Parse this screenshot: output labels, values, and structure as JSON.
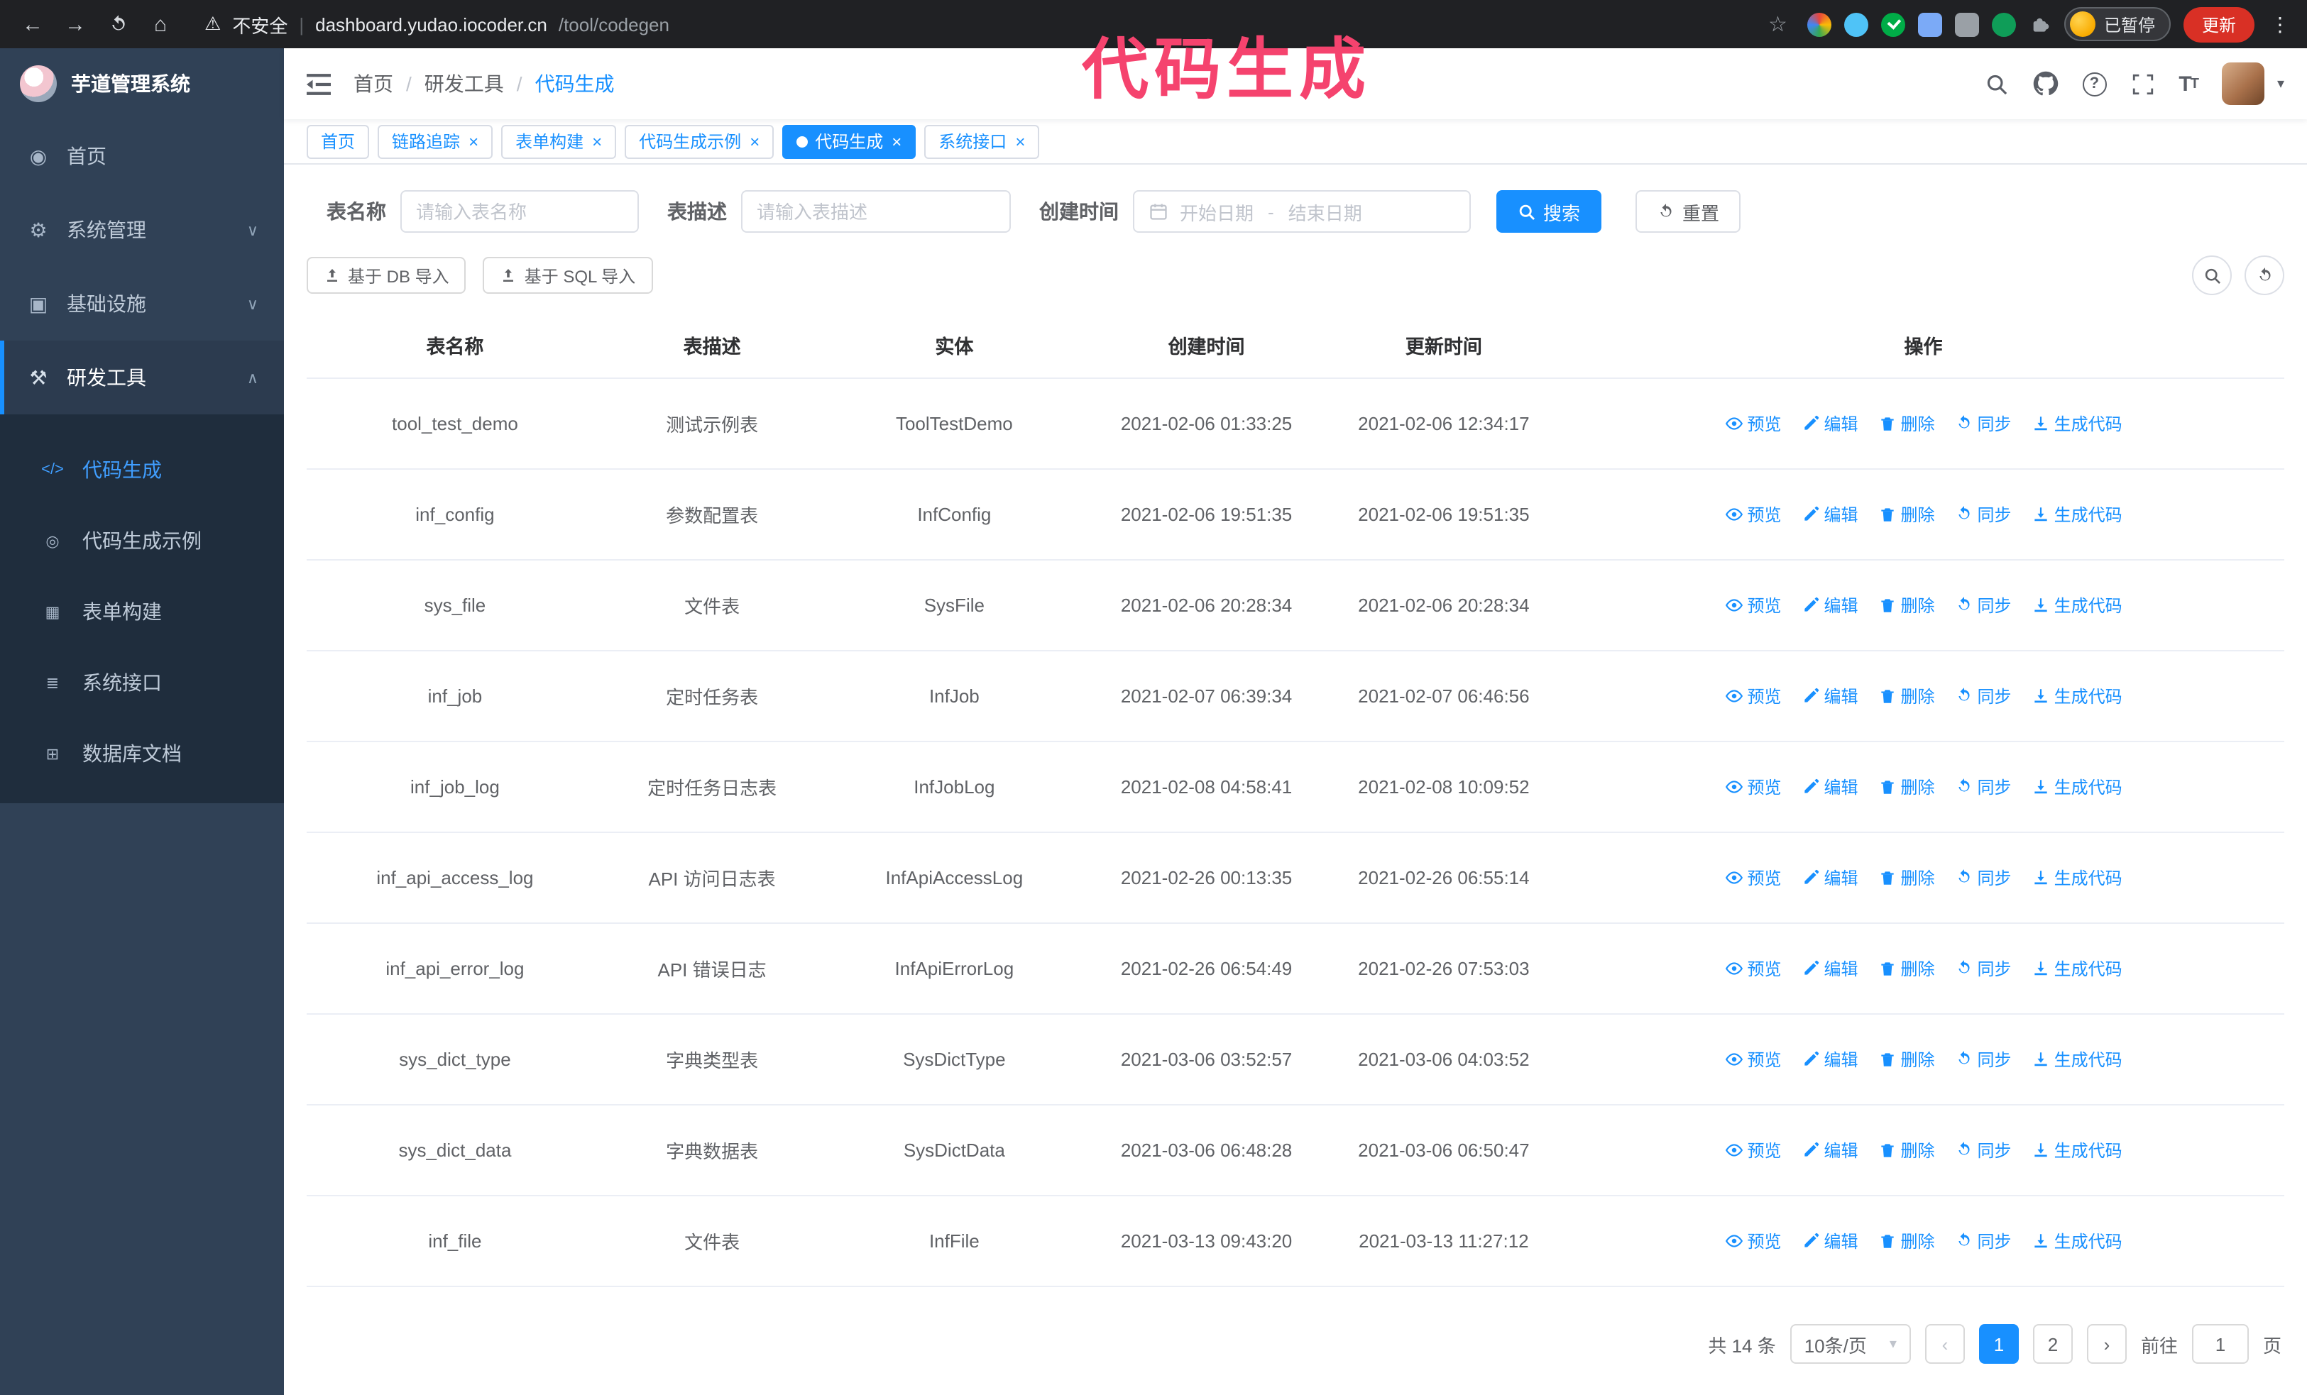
{
  "colors": {
    "accent": "#1890ff",
    "active_text": "#409eff",
    "annotation": "#f5436e",
    "sidebar_bg": "#304156",
    "sidebar_sub_bg": "#1f2d3d",
    "update_bg": "#d93025"
  },
  "annotation": {
    "text": "代码生成"
  },
  "browser": {
    "security_label": "不安全",
    "url_host": "dashboard.yudao.iocoder.cn",
    "url_path": "/tool/codegen",
    "profile_badge": "已暂停",
    "update_button": "更新"
  },
  "icons": {
    "back": "←",
    "forward": "→",
    "home": "⌂",
    "warning": "⚠",
    "divider": "|",
    "star": "☆",
    "more": "⋮",
    "question": "?",
    "close": "×",
    "chevron_down": "∨",
    "chevron_up": "∧",
    "caret_down": "▾",
    "arrow_left": "‹",
    "arrow_right": "›"
  },
  "sidebar": {
    "app_title": "芋道管理系统",
    "items": [
      {
        "label": "首页",
        "glyph": "◉"
      },
      {
        "label": "系统管理",
        "glyph": "⚙"
      },
      {
        "label": "基础设施",
        "glyph": "▣"
      },
      {
        "label": "研发工具",
        "glyph": "⚒"
      }
    ],
    "subitems": [
      {
        "label": "代码生成",
        "glyph": "</>"
      },
      {
        "label": "代码生成示例",
        "glyph": "◎"
      },
      {
        "label": "表单构建",
        "glyph": "▦"
      },
      {
        "label": "系统接口",
        "glyph": "≣"
      },
      {
        "label": "数据库文档",
        "glyph": "⊞"
      }
    ]
  },
  "header": {
    "breadcrumb": [
      "首页",
      "研发工具",
      "代码生成"
    ]
  },
  "tabs": [
    {
      "label": "首页",
      "closable": false
    },
    {
      "label": "链路追踪",
      "closable": true
    },
    {
      "label": "表单构建",
      "closable": true
    },
    {
      "label": "代码生成示例",
      "closable": true
    },
    {
      "label": "代码生成",
      "closable": true,
      "active": true
    },
    {
      "label": "系统接口",
      "closable": true
    }
  ],
  "filters": {
    "table_name_label": "表名称",
    "table_name_placeholder": "请输入表名称",
    "table_desc_label": "表描述",
    "table_desc_placeholder": "请输入表描述",
    "create_time_label": "创建时间",
    "date_start_placeholder": "开始日期",
    "date_separator": "-",
    "date_end_placeholder": "结束日期",
    "search_button": "搜索",
    "reset_button": "重置"
  },
  "toolbar": {
    "import_db": "基于 DB 导入",
    "import_sql": "基于 SQL 导入"
  },
  "table": {
    "columns": [
      "表名称",
      "表描述",
      "实体",
      "创建时间",
      "更新时间",
      "操作"
    ],
    "actions": [
      "预览",
      "编辑",
      "删除",
      "同步",
      "生成代码"
    ],
    "rows": [
      {
        "name": "tool_test_demo",
        "desc": "测试示例表",
        "entity": "ToolTestDemo",
        "created": "2021-02-06 01:33:25",
        "updated": "2021-02-06 12:34:17"
      },
      {
        "name": "inf_config",
        "desc": "参数配置表",
        "entity": "InfConfig",
        "created": "2021-02-06 19:51:35",
        "updated": "2021-02-06 19:51:35"
      },
      {
        "name": "sys_file",
        "desc": "文件表",
        "entity": "SysFile",
        "created": "2021-02-06 20:28:34",
        "updated": "2021-02-06 20:28:34"
      },
      {
        "name": "inf_job",
        "desc": "定时任务表",
        "entity": "InfJob",
        "created": "2021-02-07 06:39:34",
        "updated": "2021-02-07 06:46:56"
      },
      {
        "name": "inf_job_log",
        "desc": "定时任务日志表",
        "entity": "InfJobLog",
        "created": "2021-02-08 04:58:41",
        "updated": "2021-02-08 10:09:52"
      },
      {
        "name": "inf_api_access_log",
        "desc": "API 访问日志表",
        "entity": "InfApiAccessLog",
        "created": "2021-02-26 00:13:35",
        "updated": "2021-02-26 06:55:14"
      },
      {
        "name": "inf_api_error_log",
        "desc": "API 错误日志",
        "entity": "InfApiErrorLog",
        "created": "2021-02-26 06:54:49",
        "updated": "2021-02-26 07:53:03"
      },
      {
        "name": "sys_dict_type",
        "desc": "字典类型表",
        "entity": "SysDictType",
        "created": "2021-03-06 03:52:57",
        "updated": "2021-03-06 04:03:52"
      },
      {
        "name": "sys_dict_data",
        "desc": "字典数据表",
        "entity": "SysDictData",
        "created": "2021-03-06 06:48:28",
        "updated": "2021-03-06 06:50:47"
      },
      {
        "name": "inf_file",
        "desc": "文件表",
        "entity": "InfFile",
        "created": "2021-03-13 09:43:20",
        "updated": "2021-03-13 11:27:12"
      }
    ]
  },
  "pagination": {
    "total": "共 14 条",
    "page_size": "10条/页",
    "pages": [
      "1",
      "2"
    ],
    "active_page": "1",
    "goto_label": "前往",
    "goto_value": "1",
    "goto_suffix": "页"
  }
}
